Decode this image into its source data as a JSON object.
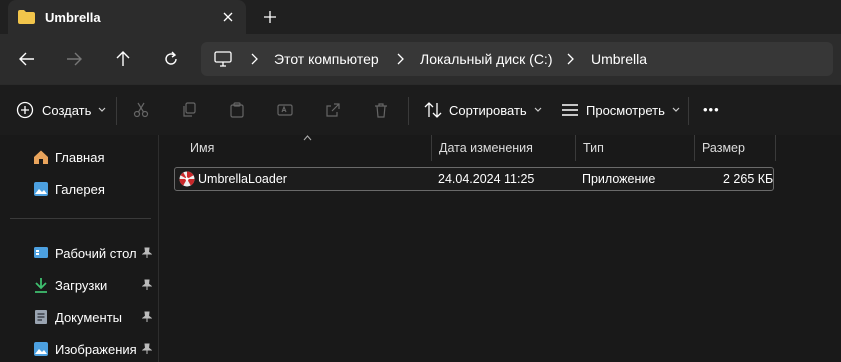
{
  "tab": {
    "title": "Umbrella"
  },
  "address": {
    "crumbs": [
      "Этот компьютер",
      "Локальный диск (C:)",
      "Umbrella"
    ]
  },
  "commands": {
    "create": "Создать",
    "sort": "Сортировать",
    "view": "Просмотреть",
    "more": "•••"
  },
  "sidebar": {
    "items": [
      {
        "label": "Главная"
      },
      {
        "label": "Галерея"
      },
      {
        "label": "Рабочий стол"
      },
      {
        "label": "Загрузки"
      },
      {
        "label": "Документы"
      },
      {
        "label": "Изображения"
      }
    ]
  },
  "list": {
    "columns": {
      "name": "Имя",
      "modified": "Дата изменения",
      "type": "Тип",
      "size": "Размер"
    },
    "rows": [
      {
        "name": "UmbrellaLoader",
        "modified": "24.04.2024 11:25",
        "type": "Приложение",
        "size": "2 265 КБ"
      }
    ]
  },
  "colors": {
    "folder": "#f2c54b",
    "accent_blue": "#4ca0e0",
    "download_green": "#3fbf6f"
  }
}
